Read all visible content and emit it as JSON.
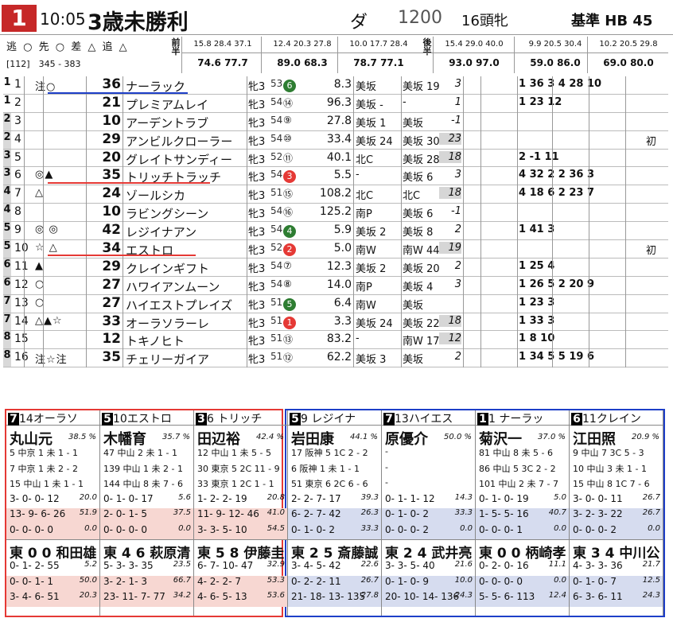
{
  "race": {
    "number": "1",
    "time": "10:05",
    "name": "3歳未勝利",
    "course": "ダ",
    "distance": "1200",
    "heads": "16頭牝",
    "standard": "基準 HB 45",
    "marks": "逃 ○ 先 ○ 差 △ 追 △",
    "race_id": "[112]　345 - 383"
  },
  "laps": {
    "zen": "前半",
    "kou": "後半",
    "groups": [
      [
        "15.8",
        "28.4",
        "37.1"
      ],
      [
        "12.4",
        "20.3",
        "27.8"
      ],
      [
        "10.0",
        "17.7",
        "28.4"
      ],
      [
        "15.4",
        "29.0",
        "40.0"
      ],
      [
        "9.9",
        "20.5",
        "30.4"
      ],
      [
        "10.2",
        "20.5",
        "29.8"
      ]
    ],
    "totals": [
      [
        "74.6",
        "77.7"
      ],
      [
        "89.0",
        "68.3"
      ],
      [
        "78.7",
        "77.1"
      ],
      [
        "93.0",
        "97.0"
      ],
      [
        "59.0",
        "86.0"
      ],
      [
        "69.0",
        "80.0"
      ]
    ]
  },
  "horses": [
    {
      "waku": "1",
      "num": "1",
      "mark": "注○",
      "idx": "36",
      "name": "ナーラック",
      "sex": "牝3",
      "wt": "53",
      "gate": "6",
      "odds": "8.3",
      "t1": "美坂",
      "t2": "美坂 19",
      "p2": "3",
      "ex": "1 36 3 4 28 10",
      "fin": ""
    },
    {
      "waku": "1",
      "num": "2",
      "mark": "",
      "idx": "21",
      "name": "プレミアムレイ",
      "sex": "牝3",
      "wt": "54",
      "gate": "⑭",
      "odds": "96.3",
      "t1": "美坂 -",
      "t2": "-",
      "p2": "1",
      "ex": "1 23 12",
      "fin": ""
    },
    {
      "waku": "2",
      "num": "3",
      "mark": "",
      "idx": "10",
      "name": "アーデントラブ",
      "sex": "牝3",
      "wt": "54",
      "gate": "⑨",
      "odds": "27.8",
      "t1": "美坂 1",
      "t2": "美坂",
      "p2": "-1",
      "ex": "",
      "fin": ""
    },
    {
      "waku": "2",
      "num": "4",
      "mark": "",
      "idx": "29",
      "name": "アンビルクローラー",
      "sex": "牝3",
      "wt": "54",
      "gate": "⑩",
      "odds": "33.4",
      "t1": "美坂 24",
      "t2": "美坂 30",
      "p2": "23",
      "ex": "",
      "fin": "初"
    },
    {
      "waku": "3",
      "num": "5",
      "mark": "",
      "idx": "20",
      "name": "グレイトサンディー",
      "sex": "牝3",
      "wt": "52",
      "gate": "⑪",
      "odds": "40.1",
      "t1": "北C",
      "t2": "美坂 28",
      "p2": "18",
      "ex": "2 -1 11",
      "fin": ""
    },
    {
      "waku": "3",
      "num": "6",
      "mark": "◎▲",
      "idx": "35",
      "name": "トリッチトラッチ",
      "sex": "牝3",
      "wt": "54",
      "gate": "3",
      "odds": "5.5",
      "t1": "-",
      "t2": "美坂 6",
      "p2": "3",
      "ex": "4 32 2 2 36 3",
      "fin": ""
    },
    {
      "waku": "4",
      "num": "7",
      "mark": "△",
      "idx": "24",
      "name": "ゾールシカ",
      "sex": "牝3",
      "wt": "51",
      "gate": "⑮",
      "odds": "108.2",
      "t1": "北C",
      "t2": "北C",
      "p2": "18",
      "ex": "4 18 6 2 23 7",
      "fin": ""
    },
    {
      "waku": "4",
      "num": "8",
      "mark": "",
      "idx": "10",
      "name": "ラビングシーン",
      "sex": "牝3",
      "wt": "54",
      "gate": "⑯",
      "odds": "125.2",
      "t1": "南P",
      "t2": "美坂 6",
      "p2": "-1",
      "ex": "",
      "fin": ""
    },
    {
      "waku": "5",
      "num": "9",
      "mark": "◎ ◎",
      "idx": "42",
      "name": "レジイナアン",
      "sex": "牝3",
      "wt": "54",
      "gate": "4",
      "odds": "5.9",
      "t1": "美坂 2",
      "t2": "美坂 8",
      "p2": "2",
      "ex": "1 41 3",
      "fin": ""
    },
    {
      "waku": "5",
      "num": "10",
      "mark": "☆ △",
      "idx": "34",
      "name": "エストロ",
      "sex": "牝3",
      "wt": "52",
      "gate": "2",
      "odds": "5.0",
      "t1": "南W",
      "t2": "南W 44",
      "p2": "19",
      "ex": "",
      "fin": "初"
    },
    {
      "waku": "6",
      "num": "11",
      "mark": "▲",
      "idx": "29",
      "name": "クレインギフト",
      "sex": "牝3",
      "wt": "54",
      "gate": "⑦",
      "odds": "12.3",
      "t1": "美坂 2",
      "t2": "美坂 20",
      "p2": "2",
      "ex": "1 25 4",
      "fin": ""
    },
    {
      "waku": "6",
      "num": "12",
      "mark": "○",
      "idx": "27",
      "name": "ハワイアンムーン",
      "sex": "牝3",
      "wt": "54",
      "gate": "⑧",
      "odds": "14.0",
      "t1": "南P",
      "t2": "美坂 4",
      "p2": "3",
      "ex": "1 26 5 2 20 9",
      "fin": ""
    },
    {
      "waku": "7",
      "num": "13",
      "mark": "○",
      "idx": "27",
      "name": "ハイエストプレイズ",
      "sex": "牝3",
      "wt": "51",
      "gate": "5",
      "odds": "6.4",
      "t1": "南W",
      "t2": "美坂",
      "p2": "",
      "ex": "1 23 3",
      "fin": ""
    },
    {
      "waku": "7",
      "num": "14",
      "mark": "△▲☆",
      "idx": "33",
      "name": "オーラソラーレ",
      "sex": "牝3",
      "wt": "51",
      "gate": "1",
      "odds": "3.3",
      "t1": "美坂 24",
      "t2": "美坂 22",
      "p2": "18",
      "ex": "1 33 3",
      "fin": ""
    },
    {
      "waku": "8",
      "num": "15",
      "mark": "",
      "idx": "12",
      "name": "トキノヒト",
      "sex": "牝3",
      "wt": "51",
      "gate": "⑬",
      "odds": "83.2",
      "t1": "-",
      "t2": "南W 17",
      "p2": "12",
      "ex": "1 8 10",
      "fin": ""
    },
    {
      "waku": "8",
      "num": "16",
      "mark": "注☆注",
      "idx": "35",
      "name": "チェリーガイア",
      "sex": "牝3",
      "wt": "51",
      "gate": "⑫",
      "odds": "62.2",
      "t1": "美坂 3",
      "t2": "美坂",
      "p2": "2",
      "ex": "1 34 5 5 19 6",
      "fin": ""
    }
  ],
  "jockeys": [
    {
      "head": "14オーラソ",
      "waku": "7",
      "jockey": "丸山元",
      "pct": "38.5 %",
      "l1": "5 中京 1 未 1 - 1",
      "l2": "7 中京 1 未 2 - 2",
      "l3": "15 中山 1 未 1 - 1",
      "s1": "3- 0- 0- 12",
      "v1": "20.0",
      "s2": "13- 9- 6- 26",
      "v2": "51.9",
      "s3": "0- 0- 0- 0",
      "v3": "0.0",
      "trainer": "東 0 0 和田雄",
      "t1": "0- 1- 2- 55",
      "tv1": "5.2",
      "t2": "0- 0- 1- 1",
      "tv2": "50.0",
      "t3": "3- 4- 6- 51",
      "tv3": "20.3"
    },
    {
      "head": "10エストロ",
      "waku": "5",
      "jockey": "木幡育",
      "pct": "35.7 %",
      "l1": "47 中山 2 未 1 - 1",
      "l2": "139 中山 1 未 2 - 1",
      "l3": "144 中山 8 未 7 - 6",
      "s1": "0- 1- 0- 17",
      "v1": "5.6",
      "s2": "2- 0- 1- 5",
      "v2": "37.5",
      "s3": "0- 0- 0- 0",
      "v3": "0.0",
      "trainer": "東 4 6 萩原清",
      "t1": "5- 3- 3- 35",
      "tv1": "23.5",
      "t2": "3- 2- 1- 3",
      "tv2": "66.7",
      "t3": "23- 11- 7- 77",
      "tv3": "34.2"
    },
    {
      "head": "6 トリッチ",
      "waku": "3",
      "jockey": "田辺裕",
      "pct": "42.4 %",
      "l1": "12 中山 1 未 5 - 5",
      "l2": "30 東京 5 2C 11 - 9",
      "l3": "33 東京 1 2C 1 - 1",
      "s1": "1- 2- 2- 19",
      "v1": "20.8",
      "s2": "11- 9- 12- 46",
      "v2": "41.0",
      "s3": "3- 3- 5- 10",
      "v3": "54.5",
      "trainer": "東 5 8 伊藤圭",
      "t1": "6- 7- 10- 47",
      "tv1": "32.9",
      "t2": "4- 2- 2- 7",
      "tv2": "53.3",
      "t3": "4- 6- 5- 13",
      "tv3": "53.6"
    },
    {
      "head": "9 レジイナ",
      "waku": "5",
      "jockey": "岩田康",
      "pct": "44.1 %",
      "l1": "17 阪神 5 1C 2 - 2",
      "l2": "6 阪神 1 未 1 - 1",
      "l3": "51 東京 6 2C 6 - 6",
      "s1": "2- 2- 7- 17",
      "v1": "39.3",
      "s2": "6- 2- 7- 42",
      "v2": "26.3",
      "s3": "0- 1- 0- 2",
      "v3": "33.3",
      "trainer": "東 2 5 斎藤誠",
      "t1": "3- 4- 5- 42",
      "tv1": "22.6",
      "t2": "0- 2- 2- 11",
      "tv2": "26.7",
      "t3": "21- 18- 13- 135",
      "tv3": "27.8"
    },
    {
      "head": "13ハイエス",
      "waku": "7",
      "jockey": "原優介",
      "pct": "50.0 %",
      "l1": "-",
      "l2": "-",
      "l3": "-",
      "s1": "0- 1- 1- 12",
      "v1": "14.3",
      "s2": "0- 1- 0- 2",
      "v2": "33.3",
      "s3": "0- 0- 0- 2",
      "v3": "0.0",
      "trainer": "東 2 4 武井亮",
      "t1": "3- 3- 5- 40",
      "tv1": "21.6",
      "t2": "0- 1- 0- 9",
      "tv2": "10.0",
      "t3": "20- 10- 14- 136",
      "tv3": "24.3"
    },
    {
      "head": "1 ナーラッ",
      "waku": "1",
      "jockey": "菊沢一",
      "pct": "37.0 %",
      "l1": "81 中山 8 未 5 - 6",
      "l2": "86 中山 5 3C 2 - 2",
      "l3": "101 中山 2 未 7 - 7",
      "s1": "0- 1- 0- 19",
      "v1": "5.0",
      "s2": "1- 5- 5- 16",
      "v2": "40.7",
      "s3": "0- 0- 0- 1",
      "v3": "0.0",
      "trainer": "東 0 0 柄崎孝",
      "t1": "0- 2- 0- 16",
      "tv1": "11.1",
      "t2": "0- 0- 0- 0",
      "tv2": "0.0",
      "t3": "5- 5- 6- 113",
      "tv3": "12.4"
    },
    {
      "head": "11クレイン",
      "waku": "6",
      "jockey": "江田照",
      "pct": "20.9 %",
      "l1": "9 中山 7 3C 5 - 3",
      "l2": "10 中山 3 未 1 - 1",
      "l3": "15 中山 8 1C 7 - 6",
      "s1": "3- 0- 0- 11",
      "v1": "26.7",
      "s2": "3- 2- 3- 22",
      "v2": "26.7",
      "s3": "0- 0- 0- 2",
      "v3": "0.0",
      "trainer": "東 3 4 中川公",
      "t1": "4- 3- 3- 36",
      "tv1": "21.7",
      "t2": "0- 1- 0- 7",
      "tv2": "12.5",
      "t3": "6- 3- 6- 11",
      "tv3": "24.3"
    }
  ],
  "colors": {
    "red": "#e53935",
    "blue": "#1e3fc8",
    "pink": "#f7d7d2",
    "lightblue": "#d6dcef"
  }
}
